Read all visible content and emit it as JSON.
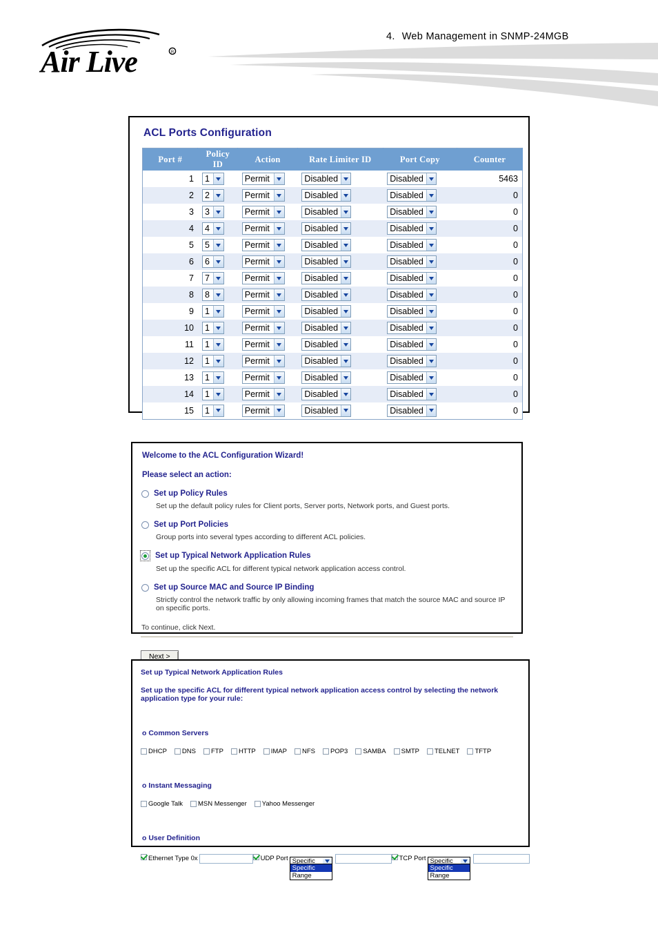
{
  "header": {
    "brand": "Air Live",
    "brand_trademark": "®",
    "section_number": "4.",
    "title": "Web  Management  in  SNMP-24MGB"
  },
  "acl_ports": {
    "title": "ACL Ports Configuration",
    "columns": [
      "Port #",
      "Policy ID",
      "Action",
      "Rate Limiter ID",
      "Port Copy",
      "Counter"
    ],
    "rows": [
      {
        "port": "1",
        "policy": "1",
        "action": "Permit",
        "rate": "Disabled",
        "copy": "Disabled",
        "counter": "5463"
      },
      {
        "port": "2",
        "policy": "2",
        "action": "Permit",
        "rate": "Disabled",
        "copy": "Disabled",
        "counter": "0"
      },
      {
        "port": "3",
        "policy": "3",
        "action": "Permit",
        "rate": "Disabled",
        "copy": "Disabled",
        "counter": "0"
      },
      {
        "port": "4",
        "policy": "4",
        "action": "Permit",
        "rate": "Disabled",
        "copy": "Disabled",
        "counter": "0"
      },
      {
        "port": "5",
        "policy": "5",
        "action": "Permit",
        "rate": "Disabled",
        "copy": "Disabled",
        "counter": "0"
      },
      {
        "port": "6",
        "policy": "6",
        "action": "Permit",
        "rate": "Disabled",
        "copy": "Disabled",
        "counter": "0"
      },
      {
        "port": "7",
        "policy": "7",
        "action": "Permit",
        "rate": "Disabled",
        "copy": "Disabled",
        "counter": "0"
      },
      {
        "port": "8",
        "policy": "8",
        "action": "Permit",
        "rate": "Disabled",
        "copy": "Disabled",
        "counter": "0"
      },
      {
        "port": "9",
        "policy": "1",
        "action": "Permit",
        "rate": "Disabled",
        "copy": "Disabled",
        "counter": "0"
      },
      {
        "port": "10",
        "policy": "1",
        "action": "Permit",
        "rate": "Disabled",
        "copy": "Disabled",
        "counter": "0"
      },
      {
        "port": "11",
        "policy": "1",
        "action": "Permit",
        "rate": "Disabled",
        "copy": "Disabled",
        "counter": "0"
      },
      {
        "port": "12",
        "policy": "1",
        "action": "Permit",
        "rate": "Disabled",
        "copy": "Disabled",
        "counter": "0"
      },
      {
        "port": "13",
        "policy": "1",
        "action": "Permit",
        "rate": "Disabled",
        "copy": "Disabled",
        "counter": "0"
      },
      {
        "port": "14",
        "policy": "1",
        "action": "Permit",
        "rate": "Disabled",
        "copy": "Disabled",
        "counter": "0"
      },
      {
        "port": "15",
        "policy": "1",
        "action": "Permit",
        "rate": "Disabled",
        "copy": "Disabled",
        "counter": "0"
      }
    ]
  },
  "wizard": {
    "heading": "Welcome to the ACL Configuration Wizard!",
    "subheading": "Please select an action:",
    "options": [
      {
        "label": "Set up Policy Rules",
        "desc": "Set up the default policy rules for Client ports, Server ports, Network ports, and Guest ports.",
        "selected": false
      },
      {
        "label": "Set up Port Policies",
        "desc": "Group ports into several types according to different ACL policies.",
        "selected": false
      },
      {
        "label": "Set up Typical Network Application Rules",
        "desc": "Set up the specific ACL for different typical network application access control.",
        "selected": true
      },
      {
        "label": "Set up Source MAC and Source IP Binding",
        "desc": "Strictly control the network traffic by only allowing incoming frames that match the source MAC and source IP on specific ports.",
        "selected": false
      }
    ],
    "continue_note": "To continue, click Next.",
    "next_button": "Next >"
  },
  "typical": {
    "heading": "Set up Typical Network Application Rules",
    "lead": "Set up the specific ACL for different typical network application access control by selecting the network application type for your rule:",
    "groups": [
      {
        "name": "o Common Servers",
        "items": [
          {
            "label": "DHCP",
            "checked": false
          },
          {
            "label": "DNS",
            "checked": false
          },
          {
            "label": "FTP",
            "checked": false
          },
          {
            "label": "HTTP",
            "checked": false
          },
          {
            "label": "IMAP",
            "checked": false
          },
          {
            "label": "NFS",
            "checked": false
          },
          {
            "label": "POP3",
            "checked": false
          },
          {
            "label": "SAMBA",
            "checked": false
          },
          {
            "label": "SMTP",
            "checked": false
          },
          {
            "label": "TELNET",
            "checked": false
          },
          {
            "label": "TFTP",
            "checked": false
          }
        ]
      },
      {
        "name": "o Instant Messaging",
        "items": [
          {
            "label": "Google Talk",
            "checked": false
          },
          {
            "label": "MSN Messenger",
            "checked": false
          },
          {
            "label": "Yahoo Messenger",
            "checked": false
          }
        ]
      }
    ],
    "user_definition": {
      "name": "o User Definition",
      "ethernet_type": {
        "label": "Ethernet Type 0x",
        "checked": true,
        "value": ""
      },
      "udp_port": {
        "label": "UDP Port",
        "checked": true,
        "selected": "Specific",
        "options": [
          "Specific",
          "Range"
        ],
        "value": ""
      },
      "tcp_port": {
        "label": "TCP Port",
        "checked": true,
        "selected": "Specific",
        "options": [
          "Specific",
          "Range"
        ],
        "value": ""
      }
    }
  },
  "colors": {
    "table_header_blue": "#6f9fd1",
    "row_alt_blue": "#e6ecf7",
    "heading_navy": "#23238e",
    "select_border": "#7f9db9",
    "dropdown_highlight": "#1438b4",
    "check_green": "#17a02f",
    "swoosh_grey": "#dcdcdc"
  }
}
